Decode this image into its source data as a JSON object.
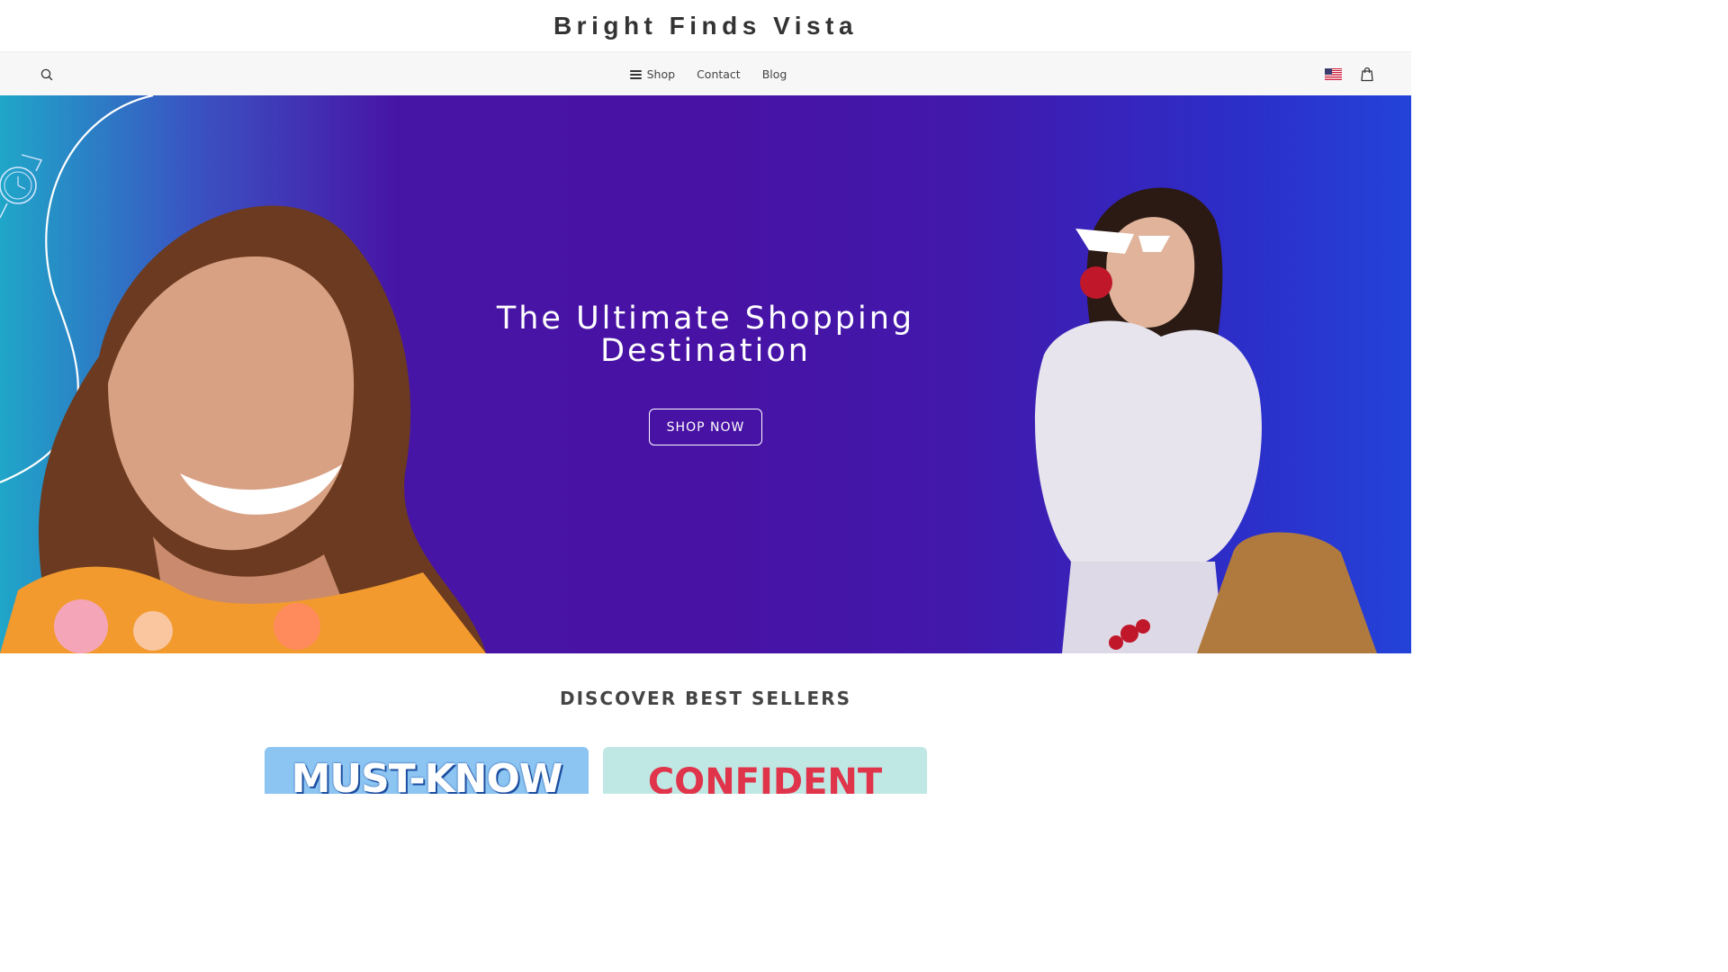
{
  "brand": {
    "title": "Bright Finds Vista"
  },
  "nav": {
    "links": [
      {
        "label": "Shop",
        "icon": "hamburger-icon"
      },
      {
        "label": "Contact"
      },
      {
        "label": "Blog"
      }
    ],
    "search_icon": "search-icon",
    "flag_icon": "us-flag-icon",
    "cart_icon": "shopping-bag-icon"
  },
  "hero": {
    "title_line1": "The Ultimate Shopping",
    "title_line2": "Destination",
    "cta_label": "SHOP NOW",
    "gradient_colors": [
      "#1fa6c8",
      "#4812a4",
      "#2343d8"
    ]
  },
  "best_sellers": {
    "heading": "DISCOVER BEST SELLERS",
    "cards": [
      {
        "text": "MUST-KNOW PET",
        "bg": "#8cc4f2"
      },
      {
        "text": "CONFIDENT",
        "bg": "#bfe8e5"
      }
    ]
  }
}
